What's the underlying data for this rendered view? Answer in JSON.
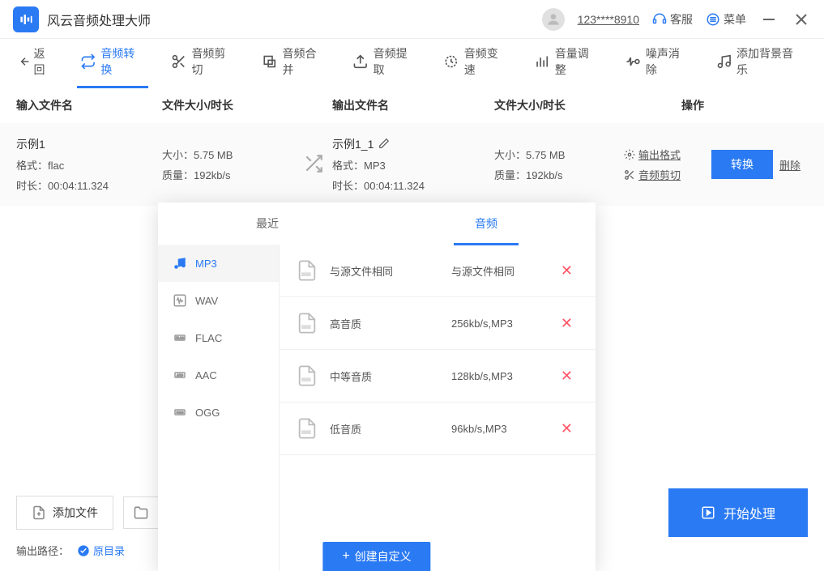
{
  "app_title": "风云音频处理大师",
  "header": {
    "user_id": "123****8910",
    "service": "客服",
    "menu": "菜单"
  },
  "toolbar": {
    "back": "返回",
    "items": [
      {
        "label": "音频转换"
      },
      {
        "label": "音频剪切"
      },
      {
        "label": "音频合并"
      },
      {
        "label": "音频提取"
      },
      {
        "label": "音频变速"
      },
      {
        "label": "音量调整"
      },
      {
        "label": "噪声消除"
      },
      {
        "label": "添加背景音乐"
      }
    ]
  },
  "table": {
    "headers": {
      "in_name": "输入文件名",
      "in_size": "文件大小/时长",
      "out_name": "输出文件名",
      "out_size": "文件大小/时长",
      "ops": "操作"
    },
    "row": {
      "in_name": "示例1",
      "in_format_label": "格式：",
      "in_format": "flac",
      "in_duration_label": "时长：",
      "in_duration": "00:04:11.324",
      "in_size_label": "大小：",
      "in_size": "5.75 MB",
      "in_quality_label": "质量：",
      "in_quality": "192kb/s",
      "out_name": "示例1_1",
      "out_format_label": "格式：",
      "out_format": "MP3",
      "out_duration_label": "时长：",
      "out_duration": "00:04:11.324",
      "out_size_label": "大小：",
      "out_size": "5.75 MB",
      "out_quality_label": "质量：",
      "out_quality": "192kb/s",
      "link_format": "输出格式",
      "link_cut": "音频剪切",
      "convert": "转换",
      "delete": "删除"
    }
  },
  "popup": {
    "tabs": {
      "recent": "最近",
      "audio": "音频"
    },
    "formats": [
      {
        "label": "MP3"
      },
      {
        "label": "WAV"
      },
      {
        "label": "FLAC"
      },
      {
        "label": "AAC"
      },
      {
        "label": "OGG"
      }
    ],
    "qualities": [
      {
        "name": "与源文件相同",
        "spec": "与源文件相同"
      },
      {
        "name": "高音质",
        "spec": "256kb/s,MP3"
      },
      {
        "name": "中等音质",
        "spec": "128kb/s,MP3"
      },
      {
        "name": "低音质",
        "spec": "96kb/s,MP3"
      }
    ],
    "create": "创建自定义"
  },
  "bottom": {
    "add_file": "添加文件",
    "start": "开始处理",
    "output_label": "输出路径：",
    "original_dir": "原目录"
  }
}
